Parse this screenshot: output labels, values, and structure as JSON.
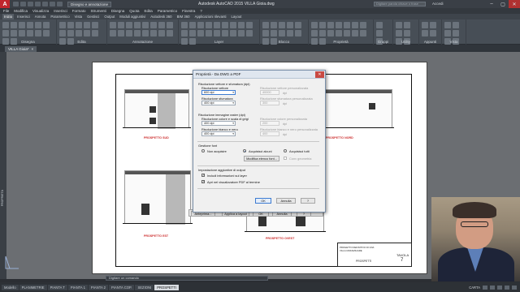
{
  "titlebar": {
    "app_letter": "A",
    "workspace": "Disegno e annotazione",
    "title": "Autodesk AutoCAD 2015   VILLA Gioia.dwg",
    "search_placeholder": "Digitare parola chiave o frase",
    "signin": "Accedi"
  },
  "menubar": [
    "File",
    "Modifica",
    "Visualizza",
    "Inserisci",
    "Formato",
    "Strumenti",
    "Disegna",
    "Quota",
    "Edita",
    "Parametrico",
    "Finestra",
    "?"
  ],
  "ribbon_tabs": [
    {
      "label": "Inizio",
      "active": true
    },
    {
      "label": "Inserisci",
      "active": false
    },
    {
      "label": "Annota",
      "active": false
    },
    {
      "label": "Parametrico",
      "active": false
    },
    {
      "label": "Vista",
      "active": false
    },
    {
      "label": "Gestisci",
      "active": false
    },
    {
      "label": "Output",
      "active": false
    },
    {
      "label": "Moduli aggiuntivi",
      "active": false
    },
    {
      "label": "Autodesk 360",
      "active": false
    },
    {
      "label": "BIM 360",
      "active": false
    },
    {
      "label": "Applicazioni rilevanti",
      "active": false
    },
    {
      "label": "Layout",
      "active": false
    }
  ],
  "ribbon_panels": [
    "Disegna",
    "Edita",
    "Annotazione",
    "Layer",
    "Blocco",
    "Proprietà",
    "Gruppi",
    "Utility",
    "Appunti",
    "Vista"
  ],
  "file_tab": {
    "label": "VILLA Gioia*",
    "close": "×"
  },
  "dialog": {
    "title": "Proprietà - Da DWG a PDF",
    "close": "✕",
    "vector_section": "Risoluzione vettore e sfumatura (dpi)",
    "vector_label": "Risoluzione vettore",
    "vector_value": "600 dpi",
    "vector_custom_label": "Risoluzione vettore personalizzata",
    "vector_custom_value": "40000",
    "vector_custom_unit": "dpi",
    "shade_label": "Risoluzione sfumatura",
    "shade_value": "400 dpi",
    "shade_custom_label": "Risoluzione sfumatura personalizzata",
    "shade_custom_value": "300",
    "shade_custom_unit": "dpi",
    "raster_section": "Risoluzione immagine raster (dpi)",
    "gray_label": "Risoluzione colore e scala di grigi",
    "gray_value": "400 dpi",
    "gray_custom_label": "Risoluzione colore personalizzata",
    "gray_custom_value": "200",
    "gray_custom_unit": "dpi",
    "bw_label": "Risoluzione bianco e nero",
    "bw_value": "400 dpi",
    "bw_custom_label": "Risoluzione bianco e nero personalizzata",
    "bw_custom_value": "400",
    "bw_custom_unit": "dpi",
    "fonts_section": "Gestione font",
    "font_opt1": "Non acquisire",
    "font_opt2": "Acquisisci alcuni",
    "font_opt3": "Acquisisci tutti",
    "font_selected": 2,
    "font_list_btn": "Modifica elenco font...",
    "convert_label": "Conv geometria",
    "extra_section": "Impostazione aggiuntive di output",
    "include_layers": "Includi informazioni sui layer",
    "open_viewer": "Apri nel visualizzatore PDF al termine",
    "ok": "OK",
    "cancel": "Annulla",
    "help": "?"
  },
  "behind_strip": {
    "preview": "Anteprima...",
    "apply": "Applica a layout",
    "ok": "OK",
    "cancel": "Annulla",
    "help": "?"
  },
  "drawing": {
    "captions": [
      "PROSPETTO SUD",
      "PROSPETTO NORD",
      "PROSPETTO EST",
      "PROSPETTO OVEST"
    ],
    "title_block": [
      "PROGETTO DEFINITIVO DI UNA",
      "VILLA UNIFAMILIARE",
      "PROSPETTI",
      "TAVOLA",
      "7"
    ]
  },
  "sidebar": {
    "viewcube_label": "PROPRIETÀ"
  },
  "cmdline": {
    "prompt": "Digitare un comando"
  },
  "layout_tabs": [
    {
      "label": "Modello",
      "active": false
    },
    {
      "label": "PLANIMETRIE",
      "active": false
    },
    {
      "label": "PIANTA T",
      "active": false
    },
    {
      "label": "PIANTA 1",
      "active": false
    },
    {
      "label": "PIANTA 2",
      "active": false
    },
    {
      "label": "PIANTA COP.",
      "active": false
    },
    {
      "label": "SEZIONI",
      "active": false
    },
    {
      "label": "PROSPETTI",
      "active": true
    }
  ],
  "status": {
    "mode": "CARTA"
  },
  "colors": {
    "accent": "#3d7bd1",
    "caption": "#cc2b2b",
    "close": "#b03131"
  }
}
